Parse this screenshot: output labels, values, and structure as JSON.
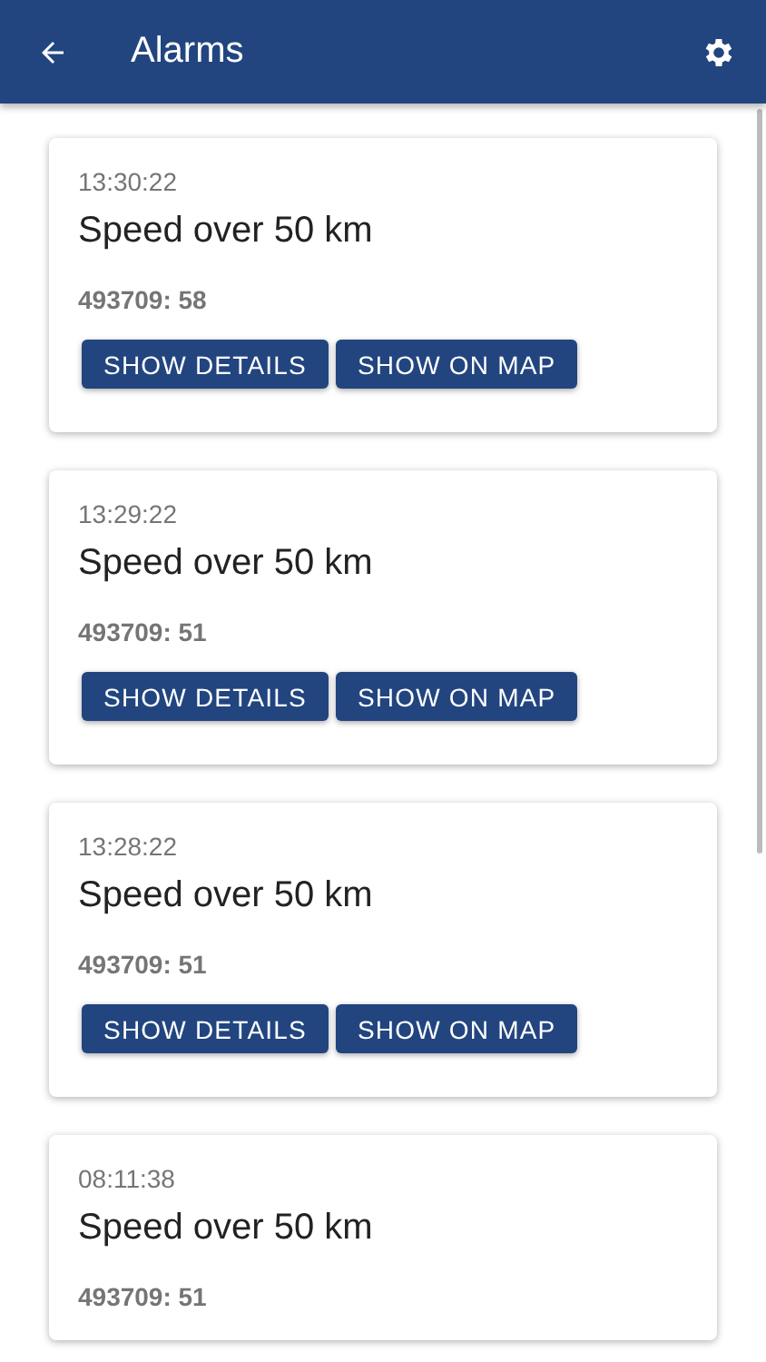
{
  "app_bar": {
    "title": "Alarms"
  },
  "alarms": [
    {
      "time": "13:30:22",
      "title": "Speed over 50 km",
      "vehicle": "493709: 58",
      "buttons": [
        "SHOW DETAILS",
        "SHOW ON MAP"
      ]
    },
    {
      "time": "13:29:22",
      "title": "Speed over 50 km",
      "vehicle": "493709: 51",
      "buttons": [
        "SHOW DETAILS",
        "SHOW ON MAP"
      ]
    },
    {
      "time": "13:28:22",
      "title": "Speed over 50 km",
      "vehicle": "493709: 51",
      "buttons": [
        "SHOW DETAILS",
        "SHOW ON MAP"
      ]
    },
    {
      "time": "08:11:38",
      "title": "Speed over 50 km",
      "vehicle": "493709: 51"
    }
  ]
}
